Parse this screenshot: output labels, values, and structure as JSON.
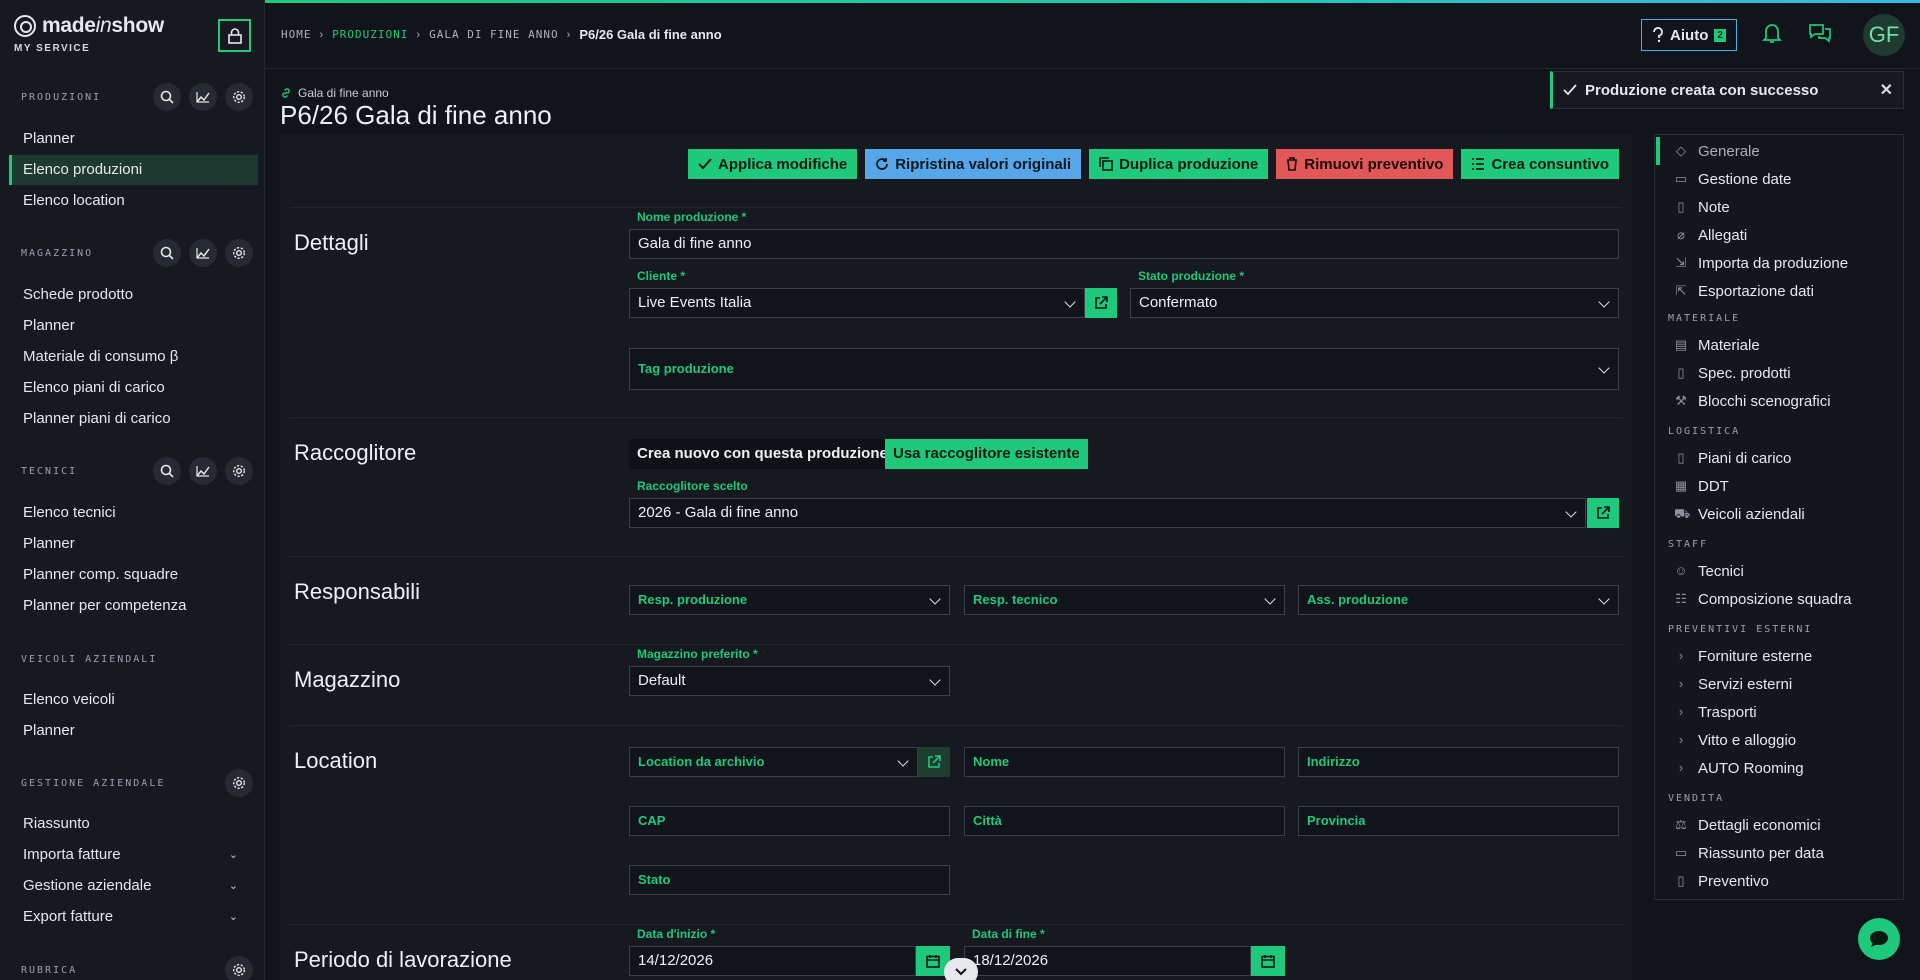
{
  "brand": {
    "name_a": "made",
    "name_b": "in",
    "name_c": "show",
    "subtitle": "MY SERVICE"
  },
  "sidebar": {
    "sections": [
      {
        "title": "PRODUZIONI",
        "items": [
          "Planner",
          "Elenco produzioni",
          "Elenco location"
        ]
      },
      {
        "title": "MAGAZZINO",
        "items": [
          "Schede prodotto",
          "Planner",
          "Materiale di consumo β",
          "Elenco piani di carico",
          "Planner piani di carico"
        ]
      },
      {
        "title": "TECNICI",
        "items": [
          "Elenco tecnici",
          "Planner",
          "Planner comp. squadre",
          "Planner per competenza"
        ]
      },
      {
        "title": "VEICOLI AZIENDALI",
        "items": [
          "Elenco veicoli",
          "Planner"
        ]
      },
      {
        "title": "GESTIONE AZIENDALE",
        "items": [
          "Riassunto",
          "Importa fatture",
          "Gestione aziendale",
          "Export fatture"
        ]
      },
      {
        "title": "RUBRICA",
        "items": []
      }
    ]
  },
  "breadcrumb": {
    "home": "HOME",
    "produzioni": "PRODUZIONI",
    "parent": "GALA DI FINE ANNO",
    "current": "P6/26 Gala di fine anno"
  },
  "topbar": {
    "help_label": "Aiuto",
    "help_badge": "2",
    "avatar_initials": "GF"
  },
  "header": {
    "subtitle": "Gala di fine anno",
    "title": "P6/26 Gala di fine anno"
  },
  "toast": {
    "message": "Produzione creata con successo",
    "close": "✕"
  },
  "actions": {
    "apply": "Applica modifiche",
    "reset": "Ripristina valori originali",
    "duplicate": "Duplica produzione",
    "remove_quote": "Rimuovi preventivo",
    "create_final": "Crea consuntivo"
  },
  "sections": {
    "dettagli": {
      "title": "Dettagli",
      "nome_label": "Nome produzione *",
      "nome_value": "Gala di fine anno",
      "cliente_label": "Cliente *",
      "cliente_value": "Live Events Italia",
      "stato_label": "Stato produzione *",
      "stato_value": "Confermato",
      "tag_placeholder": "Tag produzione"
    },
    "raccoglitore": {
      "title": "Raccoglitore",
      "toggle_new": "Crea nuovo con questa produzione",
      "toggle_existing": "Usa raccoglitore esistente",
      "scelto_label": "Raccoglitore scelto",
      "scelto_value": "2026 - Gala di fine anno"
    },
    "responsabili": {
      "title": "Responsabili",
      "resp_produzione": "Resp. produzione",
      "resp_tecnico": "Resp. tecnico",
      "ass_produzione": "Ass. produzione"
    },
    "magazzino": {
      "title": "Magazzino",
      "label": "Magazzino preferito *",
      "value": "Default"
    },
    "location": {
      "title": "Location",
      "archivio": "Location da archivio",
      "nome": "Nome",
      "indirizzo": "Indirizzo",
      "cap": "CAP",
      "citta": "Città",
      "provincia": "Provincia",
      "stato": "Stato"
    },
    "periodo": {
      "title": "Periodo di lavorazione",
      "inizio_label": "Data d'inizio *",
      "inizio_value": "14/12/2026",
      "fine_label": "Data di fine *",
      "fine_value": "18/12/2026"
    }
  },
  "rightnav": {
    "top": [
      "Generale",
      "Gestione date",
      "Note",
      "Allegati",
      "Importa da produzione",
      "Esportazione dati"
    ],
    "materiale_head": "MATERIALE",
    "materiale": [
      "Materiale",
      "Spec. prodotti",
      "Blocchi scenografici"
    ],
    "logistica_head": "LOGISTICA",
    "logistica": [
      "Piani di carico",
      "DDT",
      "Veicoli aziendali"
    ],
    "staff_head": "STAFF",
    "staff": [
      "Tecnici",
      "Composizione squadra"
    ],
    "preventivi_head": "PREVENTIVI ESTERNI",
    "preventivi": [
      "Forniture esterne",
      "Servizi esterni",
      "Trasporti",
      "Vitto e alloggio",
      "AUTO Rooming"
    ],
    "vendita_head": "VENDITA",
    "vendita": [
      "Dettagli economici",
      "Riassunto per data",
      "Preventivo"
    ]
  },
  "colors": {
    "accent": "#1ec97b",
    "blue": "#56a6e8",
    "red": "#e25757",
    "bg": "#12141b",
    "panel": "#161920"
  }
}
